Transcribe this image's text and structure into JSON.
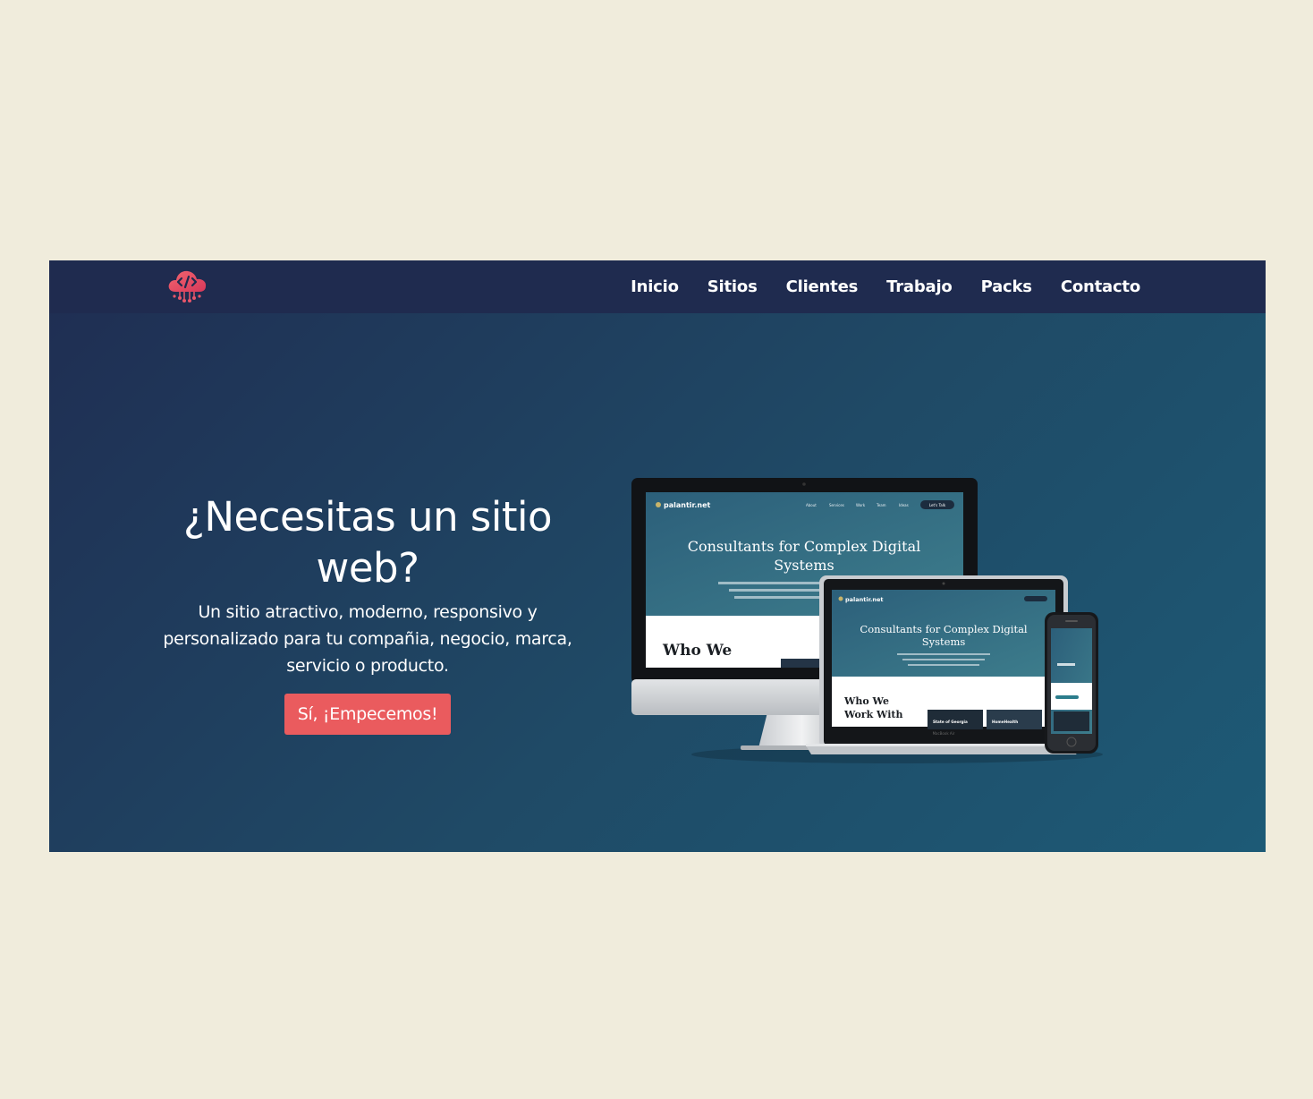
{
  "nav": {
    "items": [
      "Inicio",
      "Sitios",
      "Clientes",
      "Trabajo",
      "Packs",
      "Contacto"
    ]
  },
  "hero": {
    "title": "¿Necesitas un sitio web?",
    "subtitle": "Un sitio atractivo, moderno, responsivo y personalizado para tu compañia, negocio, marca, servicio o producto.",
    "cta_label": "Sí, ¡Empecemos!"
  },
  "mockup": {
    "site_name": "palantir.net",
    "headline_line1": "Consultants for Complex Digital",
    "headline_line2": "Systems",
    "nav": [
      "About",
      "Services",
      "Work",
      "Team",
      "Ideas"
    ],
    "button": "Let's Talk",
    "section_title_line1": "Who We",
    "section_title_line2": "Work With",
    "card1": "State of Georgia",
    "card2": "HomeHealth",
    "laptop_label": "MacBook Air"
  },
  "icons": {
    "logo": "cloud-code-icon",
    "apple": "apple-logo-icon"
  },
  "colors": {
    "page_bg": "#f0ecdc",
    "navbar_bg": "#1f2b4f",
    "hero_gradient_start": "#1f2d52",
    "hero_gradient_end": "#1d5a76",
    "accent": "#ea5b5e"
  }
}
